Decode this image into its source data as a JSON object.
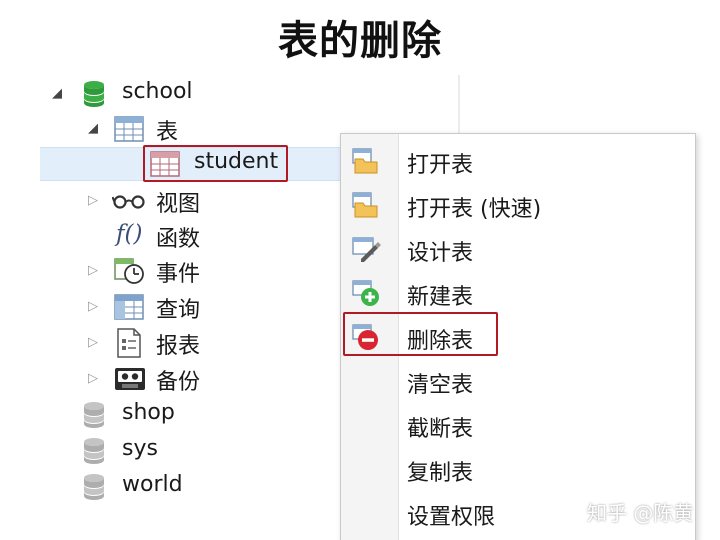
{
  "title": "表的删除",
  "tree": {
    "db_school": "school",
    "node_tables": "表",
    "table_student": "student",
    "node_views": "视图",
    "node_functions": "函数",
    "node_events": "事件",
    "node_queries": "查询",
    "node_reports": "报表",
    "node_backups": "备份",
    "db_shop": "shop",
    "db_sys": "sys",
    "db_world": "world"
  },
  "context_menu": {
    "items": [
      {
        "label": "打开表",
        "icon": "open-table-icon"
      },
      {
        "label": "打开表 (快速)",
        "icon": "open-table-fast-icon"
      },
      {
        "label": "设计表",
        "icon": "design-table-icon"
      },
      {
        "label": "新建表",
        "icon": "new-table-icon"
      },
      {
        "label": "删除表",
        "icon": "delete-table-icon"
      },
      {
        "label": "清空表",
        "icon": ""
      },
      {
        "label": "截断表",
        "icon": ""
      },
      {
        "label": "复制表",
        "icon": ""
      },
      {
        "label": "设置权限",
        "icon": ""
      }
    ]
  },
  "watermark": "知乎 @陈黄",
  "colors": {
    "db_active": "#3cae45",
    "db_inactive": "#b5b5b5",
    "highlight": "#b11a22",
    "selection": "#e3eefb",
    "delete": "#d9252f",
    "add": "#3cb44a"
  }
}
